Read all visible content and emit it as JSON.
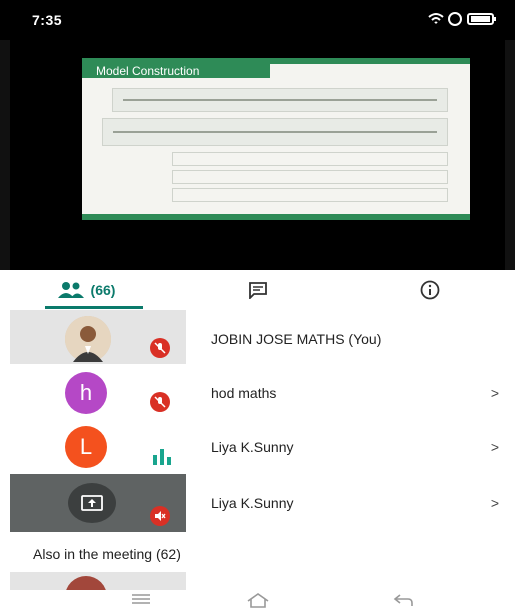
{
  "status_bar": {
    "left_text": "7:35",
    "icons": [
      "signal-icon",
      "wifi-icon",
      "battery-icon"
    ]
  },
  "presentation": {
    "title": "Model Construction"
  },
  "tabs": [
    {
      "name": "people",
      "icon": "people-icon",
      "count_label": "(66)",
      "active": true
    },
    {
      "name": "chat",
      "icon": "chat-icon"
    },
    {
      "name": "info",
      "icon": "info-icon"
    }
  ],
  "participants": [
    {
      "name": "JOBIN JOSE MATHS (You)",
      "avatar": "photo",
      "mic": "muted"
    },
    {
      "name": "hod maths",
      "avatar_letter": "h",
      "avatar_color": "#b548c6",
      "mic": "muted",
      "arrow": ">"
    },
    {
      "name": "Liya K.Sunny",
      "avatar_letter": "L",
      "avatar_color": "#f4511e",
      "mic": "speaking",
      "arrow": ">"
    },
    {
      "name": "Liya K.Sunny",
      "avatar": "screen-share",
      "mic": "audio-off",
      "arrow": ">"
    }
  ],
  "also_in_meeting": {
    "label": "Also in the meeting (62)"
  },
  "navbar": [
    "menu-icon",
    "home-icon",
    "back-icon"
  ],
  "colors": {
    "accent": "#0b7a6b",
    "mute_red": "#d93025",
    "slide_green": "#2e8b57"
  }
}
